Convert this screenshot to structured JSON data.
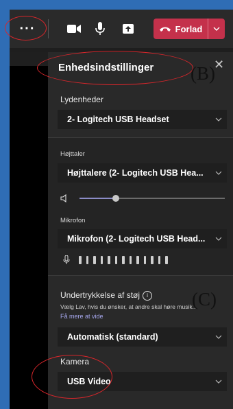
{
  "toolbar": {
    "more_icon": "more-horizontal-icon",
    "camera_icon": "video-camera-icon",
    "mic_icon": "microphone-icon",
    "share_icon": "share-screen-icon",
    "leave_label": "Forlad",
    "leave_color": "#c4314b"
  },
  "panel": {
    "title": "Enhedsindstillinger",
    "audio_devices_label": "Lydenheder",
    "audio_device_value": "2- Logitech USB Headset",
    "speaker_label": "Højttaler",
    "speaker_value": "Højttalere (2- Logitech USB Hea...",
    "speaker_volume_percent": 25,
    "microphone_label": "Mikrofon",
    "microphone_value": "Mikrofon (2- Logitech USB Head...",
    "mic_level_bars": 13,
    "noise_label": "Undertrykkelse af støj",
    "noise_help": "Vælg Lav, hvis du ønsker, at andre skal høre musik..",
    "noise_link": "Få mere at vide",
    "noise_value": "Automatisk (standard)",
    "camera_label": "Kamera",
    "camera_value": "USB Video"
  },
  "annotations": {
    "b": "(B)",
    "c": "(C)"
  }
}
